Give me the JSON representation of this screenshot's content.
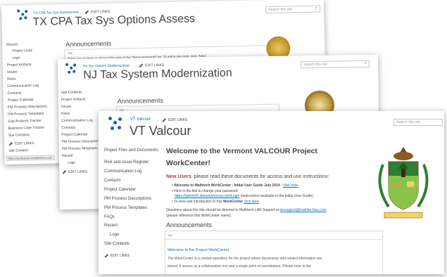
{
  "window_tx": {
    "site_link": "TX CPA Tax Sys Assessment",
    "edit_links": "EDIT LINKS",
    "title": "TX CPA Tax Sys Options Assess",
    "search_placeholder": "Search this site",
    "nav": [
      "Recent",
      "Project Links",
      "Logo",
      "Project Artifacts",
      "Issues",
      "Risks",
      "Communication Log",
      "Contacts",
      "Project Calendar",
      "PM Process Descriptions",
      "PM Process Templates",
      "Gap Analysis Tracker",
      "Business Case Tracker",
      "Site Contents"
    ],
    "nav_edit": "EDIT LINKS",
    "nav_last": "Site Content",
    "status_url": "https://workcenter.mathtechinc.com",
    "announcements_heading": "Announcements",
    "announcements_col": "Title",
    "announcements_empty": "There are no items to show in this view of the \"Announcements\" list. To add a new item, click \"New\"."
  },
  "window_nj": {
    "site_link": "NJ Tax System Modernization",
    "edit_links": "EDIT LINKS",
    "title": "NJ Tax System Modernization",
    "search_placeholder": "Search this site",
    "nav": [
      "Site Contents",
      "Project Artifacts",
      "Issues",
      "Risks",
      "Communication Log",
      "Contacts",
      "Project Calendar",
      "PM Process Descriptions",
      "PM Process Templates",
      "Recent",
      "Logo"
    ],
    "nav_edit": "EDIT LINKS",
    "announcements_heading": "Announcements",
    "announcements_col": "Title"
  },
  "window_vt": {
    "site_link": "VT Valcour",
    "edit_links": "EDIT LINKS",
    "title": "VT Valcour",
    "search_placeholder": "Search this site",
    "nav": [
      "Project Files and Documents",
      "Risk and Issue Register",
      "Communication Log",
      "Contacts",
      "Project Calendar",
      "PM Process Descriptions",
      "PM Process Templates",
      "FAQs",
      "Recent",
      "Logo",
      "Site Contents"
    ],
    "nav_edit": "EDIT LINKS",
    "welcome_line1": "Welcome to the Vermont VALCOUR Project",
    "welcome_line2": "WorkCenter!",
    "new_users": "New Users",
    "new_users_rest": ", please read these documents for access and use instructions:",
    "bullet1_bold": "Welcome to Mathtech WorkCenter - Initial User Guide July 2014",
    "bullet1_link": "click here",
    "bullet2": "Here is the link to change your password:",
    "bullet2_link": "https://admin05.sherweb/cloud.com/Login",
    "bullet2_rest": "(instructions available in the Initial User Guide)",
    "bullet3_pre": "To view and introduction to this ",
    "bullet3_bold": "WorkCenter",
    "bullet3_link": "click here",
    "questions": "Questions about this site should be directed to Mathtech LAN Support at",
    "questions_email": "lansupport@mathtechinc.com",
    "questions_2": "(please reference this WorkCenter name).",
    "announcements_heading": "Announcements",
    "announcements_col": "Title",
    "announcement_title": "Welcome to the Project WorkCenter",
    "announcement_body": "The WorkCenter is a central repository for the project where documents and related information are",
    "announcement_body2": "stored.  It serves as a collaboration tool and a single point of coordination.  Please refer to the"
  }
}
